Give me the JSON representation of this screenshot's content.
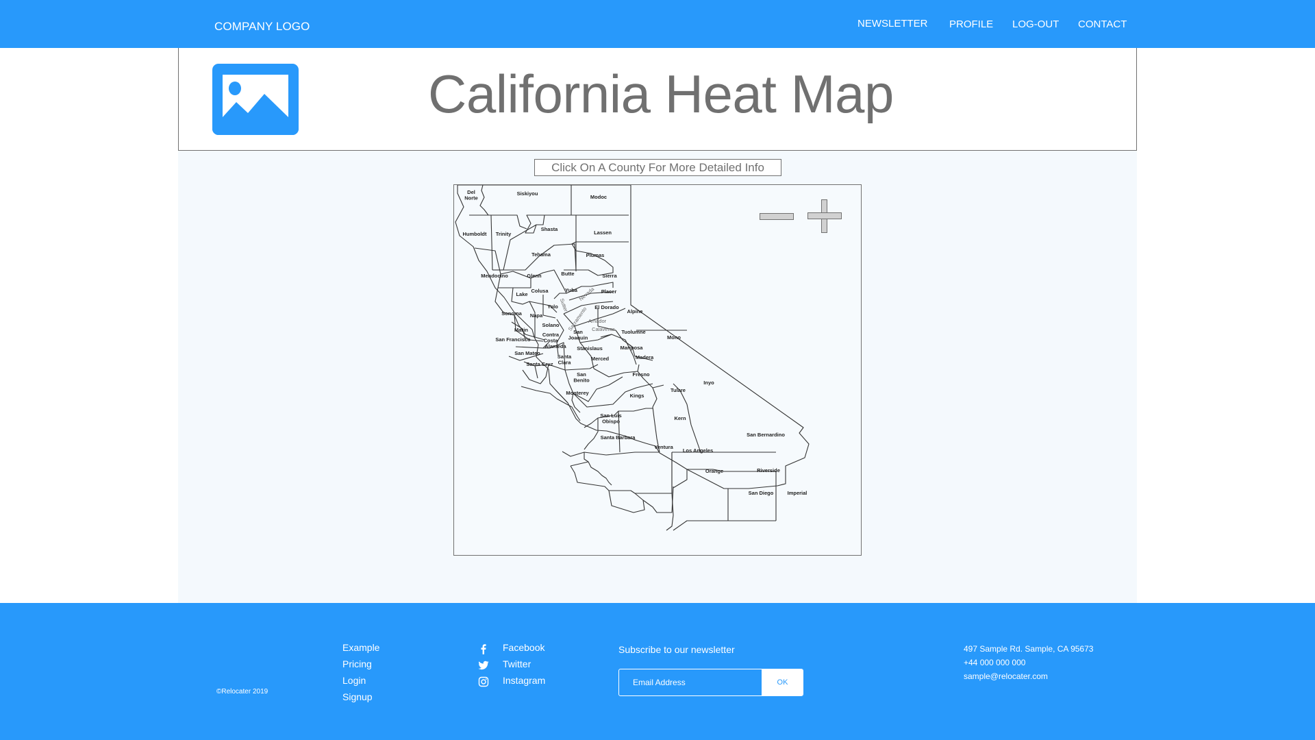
{
  "header": {
    "logo_text": "COMPANY LOGO",
    "nav": [
      {
        "label": "NEWSLETTER"
      },
      {
        "label": "PROFILE"
      },
      {
        "label": "LOG-OUT"
      },
      {
        "label": "CONTACT"
      }
    ]
  },
  "hero": {
    "icon": "image-placeholder-icon",
    "title": "California Heat Map"
  },
  "map": {
    "hint_button": "Click On A County For More Detailed Info",
    "zoom_out_icon": "minus-icon",
    "zoom_in_icon": "plus-icon",
    "counties": [
      {
        "name": "Del Norte",
        "lines": [
          "Del",
          "Norte"
        ]
      },
      {
        "name": "Siskiyou",
        "lines": [
          "Siskiyou"
        ]
      },
      {
        "name": "Modoc",
        "lines": [
          "Modoc"
        ]
      },
      {
        "name": "Humboldt",
        "lines": [
          "Humboldt"
        ]
      },
      {
        "name": "Trinity",
        "lines": [
          "Trinity"
        ]
      },
      {
        "name": "Shasta",
        "lines": [
          "Shasta"
        ]
      },
      {
        "name": "Lassen",
        "lines": [
          "Lassen"
        ]
      },
      {
        "name": "Tehama",
        "lines": [
          "Tehama"
        ]
      },
      {
        "name": "Plumas",
        "lines": [
          "Plumas"
        ]
      },
      {
        "name": "Mendocino",
        "lines": [
          "Mendocino"
        ]
      },
      {
        "name": "Glenn",
        "lines": [
          "Glenn"
        ]
      },
      {
        "name": "Butte",
        "lines": [
          "Butte"
        ]
      },
      {
        "name": "Sierra",
        "lines": [
          "Sierra"
        ]
      },
      {
        "name": "Colusa",
        "lines": [
          "Colusa"
        ]
      },
      {
        "name": "Sutter",
        "lines": [
          "Sutter"
        ]
      },
      {
        "name": "Yuba",
        "lines": [
          "Yuba"
        ]
      },
      {
        "name": "Nevada",
        "lines": [
          "Nevada"
        ]
      },
      {
        "name": "Placer",
        "lines": [
          "Placer"
        ]
      },
      {
        "name": "Lake",
        "lines": [
          "Lake"
        ]
      },
      {
        "name": "Yolo",
        "lines": [
          "Yolo"
        ]
      },
      {
        "name": "El Dorado",
        "lines": [
          "El Dorado"
        ]
      },
      {
        "name": "Sonoma",
        "lines": [
          "Sonoma"
        ]
      },
      {
        "name": "Napa",
        "lines": [
          "Napa"
        ]
      },
      {
        "name": "Sacramento",
        "lines": [
          "Sacramento"
        ]
      },
      {
        "name": "Alpine",
        "lines": [
          "Alpine"
        ]
      },
      {
        "name": "Amador",
        "lines": [
          "Amador"
        ]
      },
      {
        "name": "Solano",
        "lines": [
          "Solano"
        ]
      },
      {
        "name": "Marin",
        "lines": [
          "Marin"
        ]
      },
      {
        "name": "Calaveras",
        "lines": [
          "Calaveras"
        ]
      },
      {
        "name": "Tuolumne",
        "lines": [
          "Tuolumne"
        ]
      },
      {
        "name": "Mono",
        "lines": [
          "Mono"
        ]
      },
      {
        "name": "Contra Costa",
        "lines": [
          "Contra",
          "Costa"
        ]
      },
      {
        "name": "San Joaquin",
        "lines": [
          "San",
          "Joaquin"
        ]
      },
      {
        "name": "San Francisco",
        "lines": [
          "San Francisco"
        ]
      },
      {
        "name": "Alameda",
        "lines": [
          "Alameda"
        ]
      },
      {
        "name": "Stanislaus",
        "lines": [
          "Stanislaus"
        ]
      },
      {
        "name": "Mariposa",
        "lines": [
          "Mariposa"
        ]
      },
      {
        "name": "San Mateo",
        "lines": [
          "San Mateo"
        ]
      },
      {
        "name": "Santa Clara",
        "lines": [
          "Santa",
          "Clara"
        ]
      },
      {
        "name": "Merced",
        "lines": [
          "Merced"
        ]
      },
      {
        "name": "Madera",
        "lines": [
          "Madera"
        ]
      },
      {
        "name": "Santa Cruz",
        "lines": [
          "Santa Cruz"
        ]
      },
      {
        "name": "San Benito",
        "lines": [
          "San",
          "Benito"
        ]
      },
      {
        "name": "Fresno",
        "lines": [
          "Fresno"
        ]
      },
      {
        "name": "Inyo",
        "lines": [
          "Inyo"
        ]
      },
      {
        "name": "Monterey",
        "lines": [
          "Monterey"
        ]
      },
      {
        "name": "Kings",
        "lines": [
          "Kings"
        ]
      },
      {
        "name": "Tulare",
        "lines": [
          "Tulare"
        ]
      },
      {
        "name": "San Luis Obispo",
        "lines": [
          "San Luis",
          "Obispo"
        ]
      },
      {
        "name": "Kern",
        "lines": [
          "Kern"
        ]
      },
      {
        "name": "San Bernardino",
        "lines": [
          "San Bernardino"
        ]
      },
      {
        "name": "Santa Barbara",
        "lines": [
          "Santa Barbara"
        ]
      },
      {
        "name": "Ventura",
        "lines": [
          "Ventura"
        ]
      },
      {
        "name": "Los Angeles",
        "lines": [
          "Los Angeles"
        ]
      },
      {
        "name": "Orange",
        "lines": [
          "Orange"
        ]
      },
      {
        "name": "Riverside",
        "lines": [
          "Riverside"
        ]
      },
      {
        "name": "San Diego",
        "lines": [
          "San Diego"
        ]
      },
      {
        "name": "Imperial",
        "lines": [
          "Imperial"
        ]
      }
    ]
  },
  "footer": {
    "copyright": "©Relocater 2019",
    "links": [
      "Example",
      "Pricing",
      "Login",
      "Signup"
    ],
    "social": [
      {
        "label": "Facebook",
        "icon": "facebook-icon"
      },
      {
        "label": "Twitter",
        "icon": "twitter-icon"
      },
      {
        "label": "Instagram",
        "icon": "instagram-icon"
      }
    ],
    "newsletter": {
      "label": "Subscribe to our newsletter",
      "email_placeholder": "Email Address",
      "email_value": "",
      "submit_label": "OK"
    },
    "contact": {
      "address": "497 Sample Rd. Sample, CA 95673",
      "phone": "+44 000 000 000",
      "email": "sample@relocater.com"
    }
  },
  "colors": {
    "brand_blue": "#2899fb",
    "text_gray": "#707070",
    "content_bg": "#f4f9fd"
  }
}
